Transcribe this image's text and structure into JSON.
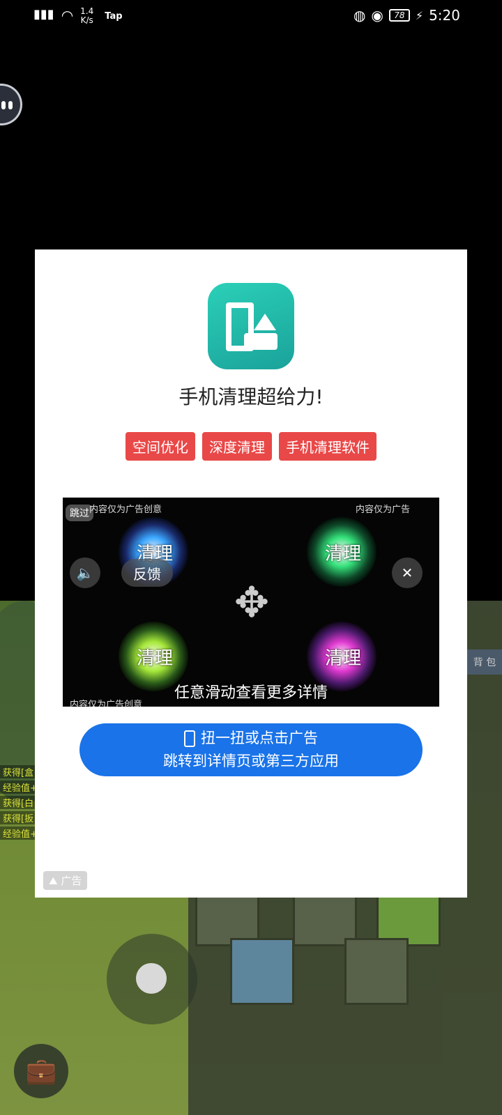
{
  "status_bar": {
    "speed_value": "1.4",
    "speed_unit": "K/s",
    "carrier_tag": "Tap",
    "battery": "78",
    "time": "5:20"
  },
  "game": {
    "log_lines": [
      "获得[盒",
      "经验值+",
      "获得[白",
      "获得[扳",
      "经验值+"
    ],
    "backpack_label": "背 包"
  },
  "ad": {
    "headline": "手机清理超给力!",
    "tags": [
      "空间优化",
      "深度清理",
      "手机清理软件"
    ],
    "video": {
      "skip_label": "跳过",
      "quad_text": "清理",
      "feedback_label": "反馈",
      "disclaimer_1": "内容仅为广告创意",
      "disclaimer_2": "内容仅为广告",
      "disclaimer_3": "内容仅为广告创意",
      "swipe_hint": "任意滑动查看更多详情"
    },
    "cta_line1": "扭一扭或点击广告",
    "cta_line2": "跳转到详情页或第三方应用",
    "badge": "广告"
  },
  "colors": {
    "tag_red": "#e94848",
    "cta_blue": "#1a73e8",
    "logo_green": "#1fb8a6"
  }
}
